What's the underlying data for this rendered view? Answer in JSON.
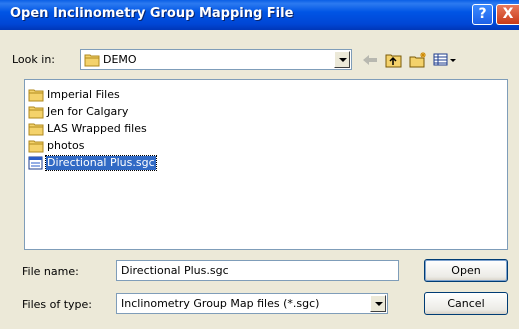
{
  "window": {
    "title": "Open Inclinometry Group Mapping File",
    "help_label": "?",
    "close_label": "X"
  },
  "lookin": {
    "label": "Look in:",
    "value": "DEMO"
  },
  "files": [
    {
      "name": "Imperial Files",
      "icon": "folder-icon",
      "selected": false
    },
    {
      "name": "Jen for Calgary",
      "icon": "folder-icon",
      "selected": false
    },
    {
      "name": "LAS Wrapped files",
      "icon": "folder-icon",
      "selected": false
    },
    {
      "name": "photos",
      "icon": "folder-icon",
      "selected": false
    },
    {
      "name": "Directional Plus.sgc",
      "icon": "sgc-file-icon",
      "selected": true
    }
  ],
  "filename": {
    "label": "File name:",
    "value": "Directional Plus.sgc"
  },
  "filetype": {
    "label": "Files of type:",
    "value": "Inclinometry Group Map files (*.sgc)"
  },
  "buttons": {
    "open": "Open",
    "cancel": "Cancel"
  }
}
